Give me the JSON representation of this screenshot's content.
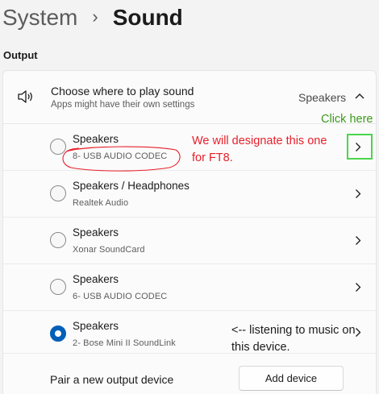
{
  "breadcrumb": {
    "parent": "System",
    "separator": "›",
    "current": "Sound"
  },
  "output_section": {
    "label": "Output",
    "header": {
      "title": "Choose where to play sound",
      "subtitle": "Apps might have their own settings",
      "selected_value": "Speakers",
      "icon": "speaker-icon",
      "expand_icon": "chevron-up-icon"
    },
    "devices": [
      {
        "name": "Speakers",
        "detail": "8- USB AUDIO  CODEC",
        "selected": false
      },
      {
        "name": "Speakers / Headphones",
        "detail": "Realtek Audio",
        "selected": false
      },
      {
        "name": "Speakers",
        "detail": "Xonar SoundCard",
        "selected": false
      },
      {
        "name": "Speakers",
        "detail": "6- USB AUDIO  CODEC",
        "selected": false
      },
      {
        "name": "Speakers",
        "detail": "2- Bose Mini II SoundLink",
        "selected": true
      }
    ],
    "pair": {
      "label": "Pair a new output device",
      "button": "Add device"
    }
  },
  "annotations": {
    "click_here": "Click here",
    "designate_line1": "We will designate this one",
    "designate_line2": "for FT8.",
    "listening_line1": "<-- listening to music on",
    "listening_line2": "this device."
  },
  "colors": {
    "accent": "#005fb8",
    "annotation_red": "#e8202b",
    "annotation_green": "#3c9a1c",
    "highlight_box": "#4bd64b"
  }
}
